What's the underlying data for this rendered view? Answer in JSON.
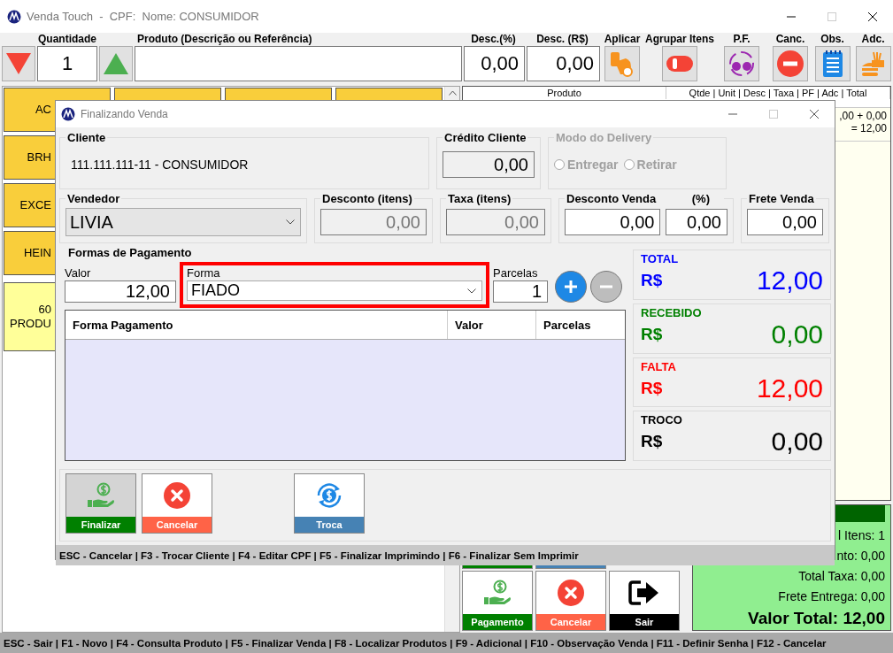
{
  "window": {
    "title": "Venda Touch  -  CPF:  Nome: CONSUMIDOR"
  },
  "toolbar": [
    {
      "kind": "quantity",
      "label": "Quantidade",
      "value": "1"
    },
    {
      "kind": "product",
      "label": "Produto (Descrição ou Referência)"
    },
    {
      "kind": "number",
      "label": "Desc.(%)",
      "value": "0,00"
    },
    {
      "kind": "number",
      "label": "Desc. (R$)",
      "value": "0,00"
    },
    {
      "kind": "icon",
      "label": "Aplicar"
    },
    {
      "kind": "icon",
      "label": "Agrupar Itens"
    },
    {
      "kind": "icon",
      "label": "P.F."
    },
    {
      "kind": "icon",
      "label": "Canc."
    },
    {
      "kind": "icon",
      "label": "Obs."
    },
    {
      "kind": "icon",
      "label": "Adc."
    }
  ],
  "product_buttons": [
    {
      "label": "AC"
    },
    {
      "label": "BRH"
    },
    {
      "label": "EXCE"
    },
    {
      "label": "HEIN"
    }
  ],
  "featured_product": {
    "lines": [
      "60",
      "PRODU"
    ]
  },
  "items_table": {
    "columns": [
      "Produto",
      "Qtde | Unit | Desc | Taxa | PF | Adc | Total"
    ],
    "rows": [
      {
        "lines": [
          ",00 + 0,00",
          "= 12,00"
        ]
      }
    ]
  },
  "summary": {
    "lines": [
      "l Itens: 1",
      "nto: 0,00",
      "Total Taxa: 0,00",
      "Frete Entrega: 0,00"
    ],
    "total": "Valor Total: 12,00"
  },
  "main_buttons": [
    {
      "label": "Pagamento",
      "color": "#008000"
    },
    {
      "label": "Cancelar",
      "color": "#ff6347"
    },
    {
      "label": "Sair",
      "color": "#000000"
    }
  ],
  "status_bar": "ESC - Sair | F1 - Novo | F4 - Consulta Produto | F5 - Finalizar Venda | F8 - Localizar Produtos | F9 - Adicional | F10 - Observação Venda | F11 - Definir Senha | F12 - Cancelar",
  "dialog": {
    "title": "Finalizando Venda",
    "cliente": {
      "label": "Cliente",
      "value": "111.111.111-11 - CONSUMIDOR"
    },
    "credito": {
      "label": "Crédito Cliente",
      "value": "0,00"
    },
    "delivery": {
      "label": "Modo do Delivery",
      "disabled": true,
      "options": [
        {
          "label": "Entregar",
          "selected": false
        },
        {
          "label": "Retirar",
          "selected": false
        }
      ]
    },
    "vendedor": {
      "label": "Vendedor",
      "value": "LIVIA"
    },
    "desconto_itens": {
      "label": "Desconto (itens)",
      "value": "0,00",
      "disabled": true
    },
    "taxa_itens": {
      "label": "Taxa (itens)",
      "value": "0,00",
      "disabled": true
    },
    "desconto_venda": {
      "label": "Desconto Venda",
      "percent_label": "(%)",
      "value": "0,00",
      "percent": "0,00"
    },
    "frete": {
      "label": "Frete Venda",
      "value": "0,00"
    },
    "pagamento": {
      "label": "Formas de Pagamento",
      "valor_label": "Valor",
      "valor": "12,00",
      "forma_label": "Forma",
      "forma": "FIADO",
      "forma_highlighted": true,
      "parcelas_label": "Parcelas",
      "parcelas": "1",
      "remove_disabled": true,
      "columns": [
        "Forma Pagamento",
        "Valor",
        "Parcelas"
      ]
    },
    "totals": [
      {
        "label": "TOTAL",
        "currency": "R$",
        "value": "12,00",
        "color": "#0000ff"
      },
      {
        "label": "RECEBIDO",
        "currency": "R$",
        "value": "0,00",
        "color": "#008000"
      },
      {
        "label": "FALTA",
        "currency": "R$",
        "value": "12,00",
        "color": "#ff0000"
      },
      {
        "label": "TROCO",
        "currency": "R$",
        "value": "0,00",
        "color": "#000000"
      }
    ],
    "buttons": [
      {
        "label": "Finalizar",
        "color": "#008000",
        "highlighted": true
      },
      {
        "label": "Cancelar",
        "color": "#ff6347",
        "highlighted": false
      },
      {
        "label": "Troca",
        "color": "#4682b4",
        "highlighted": false
      }
    ],
    "status_bar": "ESC - Cancelar | F3 - Trocar Cliente | F4 - Editar CPF | F5 - Finalizar Imprimindo | F6 - Finalizar Sem Imprimir"
  }
}
